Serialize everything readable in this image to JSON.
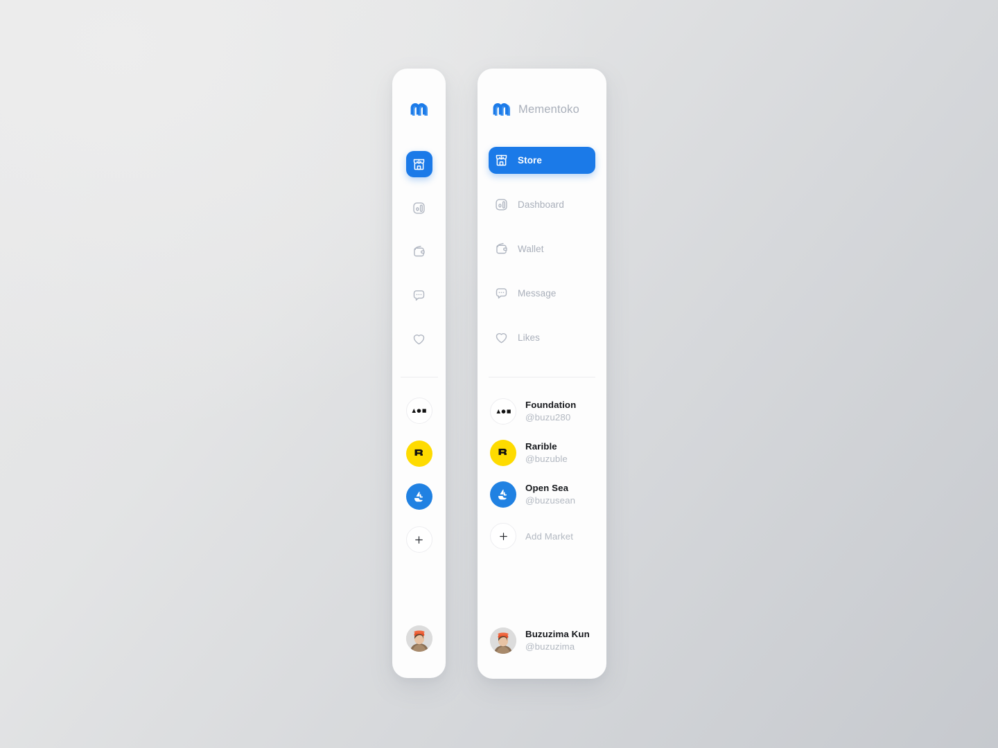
{
  "brand": {
    "name": "Mementoko",
    "logo_icon": "mementoko-m-logo",
    "accent_color": "#1b7ae8"
  },
  "nav": {
    "items": [
      {
        "label": "Store",
        "icon": "storefront-icon",
        "active": true
      },
      {
        "label": "Dashboard",
        "icon": "bar-chart-icon",
        "active": false
      },
      {
        "label": "Wallet",
        "icon": "wallet-icon",
        "active": false
      },
      {
        "label": "Message",
        "icon": "chat-bubble-icon",
        "active": false
      },
      {
        "label": "Likes",
        "icon": "heart-icon",
        "active": false
      }
    ]
  },
  "markets": {
    "items": [
      {
        "name": "Foundation",
        "handle": "@buzu280",
        "icon": "foundation-logo-icon",
        "color": "#ffffff"
      },
      {
        "name": "Rarible",
        "handle": "@buzuble",
        "icon": "rarible-logo-icon",
        "color": "#fedb00"
      },
      {
        "name": "Open Sea",
        "handle": "@buzusean",
        "icon": "opensea-logo-icon",
        "color": "#2081e2"
      }
    ],
    "add": {
      "label": "Add Market",
      "icon": "plus-icon"
    }
  },
  "user": {
    "name": "Buzuzima Kun",
    "handle": "@buzuzima",
    "avatar_icon": "user-avatar"
  }
}
